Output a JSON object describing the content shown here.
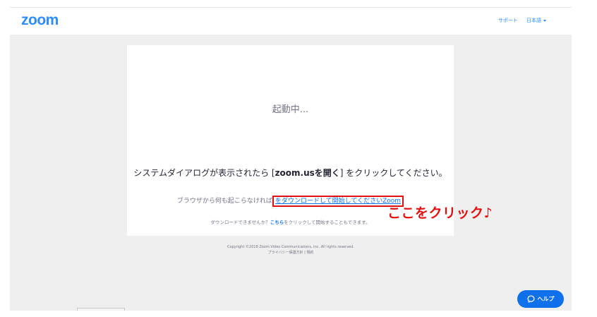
{
  "header": {
    "logo": "zoom",
    "support": "サポート",
    "language": "日本語"
  },
  "card": {
    "launching": "起動中...",
    "instruction_pre": "システムダイアログが表示されたら [",
    "instruction_bold": "zoom.usを開く",
    "instruction_post": "] をクリックしてください。",
    "browser_pre": "ブラウザから何も起こらなければ",
    "download_link": "をダウンロードして開始してくださいZoom",
    "cannot_pre": "ダウンロードできませんか？",
    "here_link": "こちら",
    "cannot_post": "をクリックして開始することもできます。"
  },
  "annotation": "ここをクリック♪",
  "footer": {
    "copyright": "Copyright ©2018 Zoom Video Communications, Inc. All rights reserved.",
    "links": "プライバシー保護方針 | 規約"
  },
  "help": {
    "label": "ヘルプ",
    "icon": "chat-bubble-icon"
  },
  "colors": {
    "brand": "#2d8cff",
    "link": "#0e71eb",
    "annotation": "#e01010",
    "background": "#efefef"
  }
}
